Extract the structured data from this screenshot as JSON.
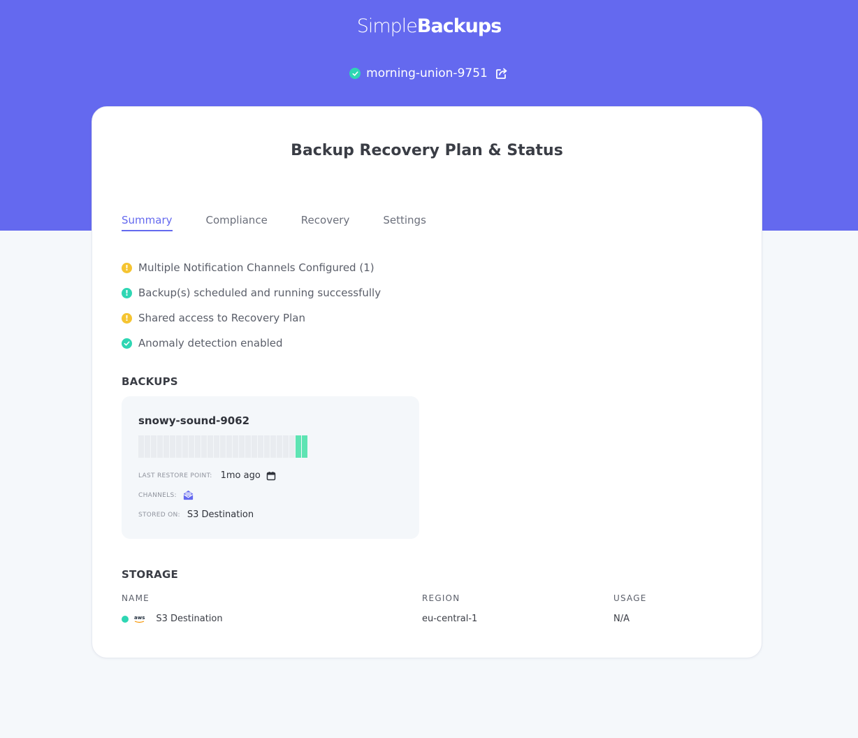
{
  "brand": {
    "logo_light": "Simple",
    "logo_bold": "Backups"
  },
  "plan": {
    "name": "morning-union-9751",
    "status_icon": "check-circle-icon",
    "share_icon": "share-icon"
  },
  "page": {
    "title": "Backup Recovery Plan & Status"
  },
  "tabs": [
    {
      "label": "Summary",
      "active": true
    },
    {
      "label": "Compliance",
      "active": false
    },
    {
      "label": "Recovery",
      "active": false
    },
    {
      "label": "Settings",
      "active": false
    }
  ],
  "checks": [
    {
      "label": "Multiple Notification Channels Configured (1)",
      "status": "warning",
      "icon": "exclamation-icon",
      "color": "#f5c431"
    },
    {
      "label": "Backup(s) scheduled and running successfully",
      "status": "ok",
      "icon": "exclamation-icon",
      "color": "#2ed6b3"
    },
    {
      "label": "Shared access to Recovery Plan",
      "status": "warning",
      "icon": "exclamation-icon",
      "color": "#f5c431"
    },
    {
      "label": "Anomaly detection enabled",
      "status": "ok",
      "icon": "check-icon",
      "color": "#2ed6b3"
    }
  ],
  "backups": {
    "heading": "BACKUPS",
    "items": [
      {
        "name": "snowy-sound-9062",
        "history_total": 27,
        "history_success": 2,
        "last_restore_label": "LAST RESTORE POINT:",
        "last_restore_value": "1mo ago",
        "channels_label": "CHANNELS:",
        "channel_icon": "email-icon",
        "stored_on_label": "STORED ON:",
        "stored_on_value": "S3 Destination"
      }
    ]
  },
  "storage": {
    "heading": "STORAGE",
    "columns": {
      "name": "NAME",
      "region": "REGION",
      "usage": "USAGE"
    },
    "rows": [
      {
        "provider": "aws",
        "name": "S3 Destination",
        "region": "eu-central-1",
        "usage": "N/A"
      }
    ]
  },
  "colors": {
    "brand": "#6469ef",
    "success": "#2ed6b3",
    "warning": "#f5c431",
    "bar_ok": "#5ee4b3",
    "bar_empty": "#e9ecf0"
  }
}
